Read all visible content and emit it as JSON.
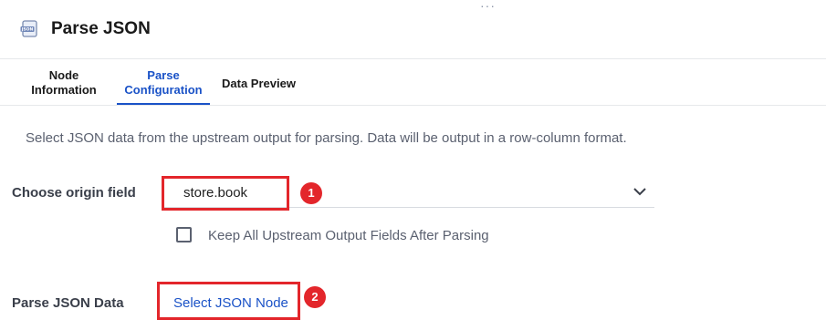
{
  "window": {
    "drag_handle": "···"
  },
  "header": {
    "title": "Parse JSON",
    "icon": "json-file-icon"
  },
  "tabs": [
    {
      "label": "Node\nInformation",
      "active": false
    },
    {
      "label": "Parse\nConfiguration",
      "active": true
    },
    {
      "label": "Data Preview",
      "active": false
    }
  ],
  "description": "Select JSON data from the upstream output for parsing. Data will be output in a row-column format.",
  "origin_field": {
    "label": "Choose origin field",
    "value": "store.book"
  },
  "keep_fields": {
    "label": "Keep All Upstream Output Fields After Parsing",
    "checked": false
  },
  "parse_data": {
    "label": "Parse JSON Data",
    "link": "Select JSON Node"
  },
  "annotations": [
    {
      "number": "1",
      "color": "#e3262b"
    },
    {
      "number": "2",
      "color": "#e3262b"
    }
  ],
  "colors": {
    "accent": "#1a52c7",
    "annotation": "#e3262b"
  }
}
